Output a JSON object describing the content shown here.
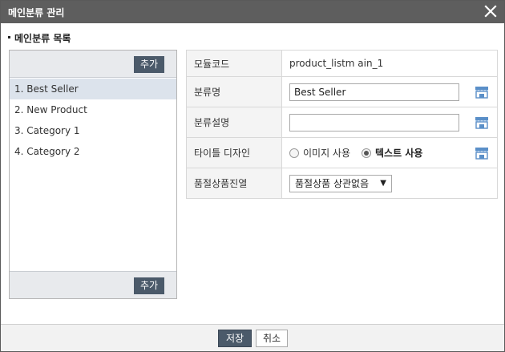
{
  "dialog": {
    "title": "메인분류 관리"
  },
  "section": {
    "title": "메인분류 목록"
  },
  "list": {
    "add_label": "추가",
    "items": [
      "1. Best Seller",
      "2. New Product",
      "3. Category 1",
      "4. Category 2"
    ]
  },
  "form": {
    "module_code": {
      "label": "모듈코드",
      "value": "product_listm ain_1"
    },
    "category_name": {
      "label": "분류명",
      "value": "Best Seller"
    },
    "category_desc": {
      "label": "분류설명",
      "value": ""
    },
    "title_design": {
      "label": "타이틀 디자인",
      "option_image": "이미지 사용",
      "option_text": "텍스트 사용",
      "selected": "text"
    },
    "soldout": {
      "label": "품절상품진열",
      "selected": "품절상품 상관없음"
    }
  },
  "footer": {
    "save_label": "저장",
    "cancel_label": "취소"
  },
  "colors": {
    "titlebar": "#5e5e5e",
    "accent_button": "#4b5a6a",
    "selected_row": "#dce3ec",
    "icon": "#5a8fc8"
  },
  "icons": {
    "close": "close-icon",
    "store": "store-icon"
  }
}
